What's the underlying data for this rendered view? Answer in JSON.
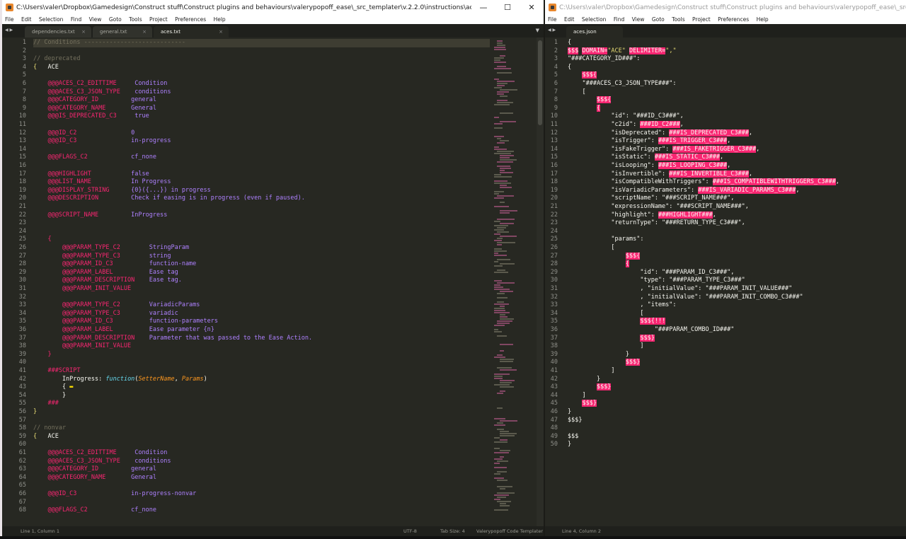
{
  "left_window": {
    "title": "C:\\Users\\valer\\Dropbox\\Gamedesign\\Construct stuff\\Construct plugins and behaviours\\valerypopoff_ease\\_src_templater\\v.2.2.0\\instructions\\aces.txt - Sublime Text (UNREGISTERED)",
    "controls": [
      "—",
      "☐",
      "✕"
    ],
    "menu": [
      "File",
      "Edit",
      "Selection",
      "Find",
      "View",
      "Goto",
      "Tools",
      "Project",
      "Preferences",
      "Help"
    ],
    "tabs": [
      "dependencies.txt",
      "general.txt",
      "aces.txt"
    ],
    "status": {
      "position": "Line 1, Column 1",
      "encoding": "UTF-8",
      "tab_size": "Tab Size: 4",
      "syntax": "Valerypopoff Code Templater"
    }
  },
  "right_window": {
    "title": "C:\\Users\\valer\\Dropbox\\Gamedesign\\Construct stuff\\Construct plugins and behaviours\\valerypopoff_ease\\_src_templater\\v.2.2.0\\templates\\###",
    "menu": [
      "File",
      "Edit",
      "Selection",
      "Find",
      "View",
      "Goto",
      "Tools",
      "Project",
      "Preferences",
      "Help"
    ],
    "tabs": [
      "aces.json"
    ],
    "status": {
      "position": "Line 4, Column 2"
    }
  },
  "left_code": [
    {
      "n": "1",
      "t": [
        [
          "c",
          "// Conditions ----------------------------"
        ]
      ]
    },
    {
      "n": "2",
      "t": []
    },
    {
      "n": "3",
      "t": [
        [
          "c",
          "// deprecated"
        ]
      ]
    },
    {
      "n": "4",
      "t": [
        [
          "s",
          "{"
        ],
        [
          "w",
          "   ACE"
        ]
      ]
    },
    {
      "n": "5",
      "t": []
    },
    {
      "n": "6",
      "t": [
        [
          "k",
          "    @@@ACES_C2_EDITTIME"
        ],
        [
          "v",
          "     Condition"
        ]
      ]
    },
    {
      "n": "7",
      "t": [
        [
          "k",
          "    @@@ACES_C3_JSON_TYPE"
        ],
        [
          "v",
          "    conditions"
        ]
      ]
    },
    {
      "n": "8",
      "t": [
        [
          "k",
          "    @@@CATEGORY_ID"
        ],
        [
          "v",
          "         general"
        ]
      ]
    },
    {
      "n": "9",
      "t": [
        [
          "k",
          "    @@@CATEGORY_NAME"
        ],
        [
          "v",
          "       General"
        ]
      ]
    },
    {
      "n": "10",
      "t": [
        [
          "k",
          "    @@@IS_DEPRECATED_C3"
        ],
        [
          "v",
          "     true"
        ]
      ]
    },
    {
      "n": "11",
      "t": []
    },
    {
      "n": "12",
      "t": [
        [
          "k",
          "    @@@ID_C2"
        ],
        [
          "v",
          "               0"
        ]
      ]
    },
    {
      "n": "13",
      "t": [
        [
          "k",
          "    @@@ID_C3"
        ],
        [
          "v",
          "               in-progress"
        ]
      ]
    },
    {
      "n": "14",
      "t": []
    },
    {
      "n": "15",
      "t": [
        [
          "k",
          "    @@@FLAGS_C2"
        ],
        [
          "v",
          "            cf_none"
        ]
      ]
    },
    {
      "n": "16",
      "t": []
    },
    {
      "n": "17",
      "t": [
        [
          "k",
          "    @@@HIGHLIGHT"
        ],
        [
          "v",
          "           false"
        ]
      ]
    },
    {
      "n": "18",
      "t": [
        [
          "k",
          "    @@@LIST_NAME"
        ],
        [
          "v",
          "           In Progress"
        ]
      ]
    },
    {
      "n": "19",
      "t": [
        [
          "k",
          "    @@@DISPLAY_STRING"
        ],
        [
          "v",
          "      {0}({...}) in progress"
        ]
      ]
    },
    {
      "n": "20",
      "t": [
        [
          "k",
          "    @@@DESCRIPTION"
        ],
        [
          "v",
          "         Check if easing is in progress (even if paused)."
        ]
      ]
    },
    {
      "n": "21",
      "t": []
    },
    {
      "n": "22",
      "t": [
        [
          "k",
          "    @@@SCRIPT_NAME"
        ],
        [
          "v",
          "         InProgress"
        ]
      ]
    },
    {
      "n": "23",
      "t": []
    },
    {
      "n": "24",
      "t": []
    },
    {
      "n": "25",
      "t": [
        [
          "k",
          "    {"
        ]
      ]
    },
    {
      "n": "26",
      "t": [
        [
          "k",
          "        @@@PARAM_TYPE_C2"
        ],
        [
          "v",
          "        StringParam"
        ]
      ]
    },
    {
      "n": "27",
      "t": [
        [
          "k",
          "        @@@PARAM_TYPE_C3"
        ],
        [
          "v",
          "        string"
        ]
      ]
    },
    {
      "n": "28",
      "t": [
        [
          "k",
          "        @@@PARAM_ID_C3"
        ],
        [
          "v",
          "          function-name"
        ]
      ]
    },
    {
      "n": "29",
      "t": [
        [
          "k",
          "        @@@PARAM_LABEL"
        ],
        [
          "v",
          "          Ease tag"
        ]
      ]
    },
    {
      "n": "30",
      "t": [
        [
          "k",
          "        @@@PARAM_DESCRIPTION"
        ],
        [
          "v",
          "    Ease tag."
        ]
      ]
    },
    {
      "n": "31",
      "t": [
        [
          "k",
          "        @@@PARAM_INIT_VALUE"
        ]
      ]
    },
    {
      "n": "32",
      "t": []
    },
    {
      "n": "33",
      "t": [
        [
          "k",
          "        @@@PARAM_TYPE_C2"
        ],
        [
          "v",
          "        VariadicParams"
        ]
      ]
    },
    {
      "n": "34",
      "t": [
        [
          "k",
          "        @@@PARAM_TYPE_C3"
        ],
        [
          "v",
          "        variadic"
        ]
      ]
    },
    {
      "n": "35",
      "t": [
        [
          "k",
          "        @@@PARAM_ID_C3"
        ],
        [
          "v",
          "          function-parameters"
        ]
      ]
    },
    {
      "n": "36",
      "t": [
        [
          "k",
          "        @@@PARAM_LABEL"
        ],
        [
          "v",
          "          Ease parameter {n}"
        ]
      ]
    },
    {
      "n": "37",
      "t": [
        [
          "k",
          "        @@@PARAM_DESCRIPTION"
        ],
        [
          "v",
          "    Parameter that was passed to the Ease Action."
        ]
      ]
    },
    {
      "n": "38",
      "t": [
        [
          "k",
          "        @@@PARAM_INIT_VALUE"
        ]
      ]
    },
    {
      "n": "39",
      "t": [
        [
          "k",
          "    }"
        ]
      ]
    },
    {
      "n": "40",
      "t": []
    },
    {
      "n": "41",
      "t": [
        [
          "k",
          "    ###SCRIPT"
        ]
      ]
    },
    {
      "n": "42",
      "t": [
        [
          "w",
          "        InProgress: "
        ],
        [
          "f",
          "function"
        ],
        [
          "w",
          "("
        ],
        [
          "p",
          "SetterName"
        ],
        [
          "w",
          ", "
        ],
        [
          "p",
          "Params"
        ],
        [
          "w",
          ")"
        ]
      ]
    },
    {
      "n": "43",
      "t": [
        [
          "w",
          "        { "
        ],
        [
          "dot",
          "▬"
        ]
      ]
    },
    {
      "n": "54",
      "t": [
        [
          "w",
          "        }"
        ]
      ]
    },
    {
      "n": "55",
      "t": [
        [
          "k",
          "    ###"
        ]
      ]
    },
    {
      "n": "56",
      "t": [
        [
          "s",
          "}"
        ]
      ]
    },
    {
      "n": "57",
      "t": []
    },
    {
      "n": "58",
      "t": [
        [
          "c",
          "// nonvar"
        ]
      ]
    },
    {
      "n": "59",
      "t": [
        [
          "s",
          "{"
        ],
        [
          "w",
          "   ACE"
        ]
      ]
    },
    {
      "n": "60",
      "t": []
    },
    {
      "n": "61",
      "t": [
        [
          "k",
          "    @@@ACES_C2_EDITTIME"
        ],
        [
          "v",
          "     Condition"
        ]
      ]
    },
    {
      "n": "62",
      "t": [
        [
          "k",
          "    @@@ACES_C3_JSON_TYPE"
        ],
        [
          "v",
          "    conditions"
        ]
      ]
    },
    {
      "n": "63",
      "t": [
        [
          "k",
          "    @@@CATEGORY_ID"
        ],
        [
          "v",
          "         general"
        ]
      ]
    },
    {
      "n": "64",
      "t": [
        [
          "k",
          "    @@@CATEGORY_NAME"
        ],
        [
          "v",
          "       General"
        ]
      ]
    },
    {
      "n": "65",
      "t": []
    },
    {
      "n": "66",
      "t": [
        [
          "k",
          "    @@@ID_C3"
        ],
        [
          "v",
          "               in-progress-nonvar"
        ]
      ]
    },
    {
      "n": "67",
      "t": []
    },
    {
      "n": "68",
      "t": [
        [
          "k",
          "    @@@FLAGS_C2"
        ],
        [
          "v",
          "            cf_none"
        ]
      ]
    }
  ],
  "right_code": [
    {
      "n": "1",
      "t": [
        [
          "w",
          "{"
        ]
      ]
    },
    {
      "n": "2",
      "t": [
        [
          "hl",
          "$$$"
        ],
        [
          "w",
          " "
        ],
        [
          "hl",
          "DOMAIN="
        ],
        [
          "s",
          "\"ACE\""
        ],
        [
          "w",
          " "
        ],
        [
          "hl",
          "DELIMITER="
        ],
        [
          "s",
          "\",\""
        ]
      ]
    },
    {
      "n": "3",
      "t": [
        [
          "w",
          "\"###CATEGORY_ID###\":"
        ]
      ]
    },
    {
      "n": "4",
      "t": [
        [
          "w",
          "{"
        ]
      ]
    },
    {
      "n": "5",
      "t": [
        [
          "w",
          "    "
        ],
        [
          "hl",
          "$$${"
        ]
      ]
    },
    {
      "n": "6",
      "t": [
        [
          "w",
          "    \"###ACES_C3_JSON_TYPE###\":"
        ]
      ]
    },
    {
      "n": "7",
      "t": [
        [
          "w",
          "    ["
        ]
      ]
    },
    {
      "n": "8",
      "t": [
        [
          "w",
          "        "
        ],
        [
          "hl",
          "$$${"
        ]
      ]
    },
    {
      "n": "9",
      "t": [
        [
          "w",
          "        "
        ],
        [
          "hl",
          "{"
        ]
      ]
    },
    {
      "n": "10",
      "t": [
        [
          "w",
          "            \"id\": \"###ID_C3###\","
        ]
      ]
    },
    {
      "n": "11",
      "t": [
        [
          "w",
          "            \"c2id\": "
        ],
        [
          "hl",
          "###ID_C2###"
        ],
        [
          "w",
          ","
        ]
      ]
    },
    {
      "n": "12",
      "t": [
        [
          "w",
          "            \"isDeprecated\": "
        ],
        [
          "hl",
          "###IS_DEPRECATED_C3###"
        ],
        [
          "w",
          ","
        ]
      ]
    },
    {
      "n": "13",
      "t": [
        [
          "w",
          "            \"isTrigger\": "
        ],
        [
          "hl",
          "###IS_TRIGGER_C3###"
        ],
        [
          "w",
          ","
        ]
      ]
    },
    {
      "n": "14",
      "t": [
        [
          "w",
          "            \"isFakeTrigger\": "
        ],
        [
          "hl",
          "###IS_FAKETRIGGER_C3###"
        ],
        [
          "w",
          ","
        ]
      ]
    },
    {
      "n": "15",
      "t": [
        [
          "w",
          "            \"isStatic\": "
        ],
        [
          "hl",
          "###IS_STATIC_C3###"
        ],
        [
          "w",
          ","
        ]
      ]
    },
    {
      "n": "16",
      "t": [
        [
          "w",
          "            \"isLooping\": "
        ],
        [
          "hl",
          "###IS_LOOPING_C3###"
        ],
        [
          "w",
          ","
        ]
      ]
    },
    {
      "n": "17",
      "t": [
        [
          "w",
          "            \"isInvertible\": "
        ],
        [
          "hl",
          "###IS_INVERTIBLE_C3###"
        ],
        [
          "w",
          ","
        ]
      ]
    },
    {
      "n": "18",
      "t": [
        [
          "w",
          "            \"isCompatibleWithTriggers\": "
        ],
        [
          "hl",
          "###IS_COMPATIBLEWITHTRIGGERS_C3###"
        ],
        [
          "w",
          ","
        ]
      ]
    },
    {
      "n": "19",
      "t": [
        [
          "w",
          "            \"isVariadicParameters\": "
        ],
        [
          "hl",
          "###IS_VARIADIC_PARAMS_C3###"
        ],
        [
          "w",
          ","
        ]
      ]
    },
    {
      "n": "20",
      "t": [
        [
          "w",
          "            \"scriptName\": \"###SCRIPT_NAME###\","
        ]
      ]
    },
    {
      "n": "21",
      "t": [
        [
          "w",
          "            \"expressionName\": \"###SCRIPT_NAME###\","
        ]
      ]
    },
    {
      "n": "22",
      "t": [
        [
          "w",
          "            \"highlight\": "
        ],
        [
          "hl",
          "###HIGHLIGHT###"
        ],
        [
          "w",
          ","
        ]
      ]
    },
    {
      "n": "23",
      "t": [
        [
          "w",
          "            \"returnType\": \"###RETURN_TYPE_C3###\","
        ]
      ]
    },
    {
      "n": "24",
      "t": []
    },
    {
      "n": "25",
      "t": [
        [
          "w",
          "            \"params\":"
        ]
      ]
    },
    {
      "n": "26",
      "t": [
        [
          "w",
          "            ["
        ]
      ]
    },
    {
      "n": "27",
      "t": [
        [
          "w",
          "                "
        ],
        [
          "hl",
          "$$${"
        ]
      ]
    },
    {
      "n": "28",
      "t": [
        [
          "w",
          "                "
        ],
        [
          "hl",
          "{"
        ]
      ]
    },
    {
      "n": "29",
      "t": [
        [
          "w",
          "                    \"id\": \"###PARAM_ID_C3###\","
        ]
      ]
    },
    {
      "n": "30",
      "t": [
        [
          "w",
          "                    \"type\": \"###PARAM_TYPE_C3###\""
        ]
      ]
    },
    {
      "n": "31",
      "t": [
        [
          "w",
          "                    , \"initialValue\": \"###PARAM_INIT_VALUE###\""
        ]
      ]
    },
    {
      "n": "32",
      "t": [
        [
          "w",
          "                    , \"initialValue\": \"###PARAM_INIT_COMBO_C3###\""
        ]
      ]
    },
    {
      "n": "33",
      "t": [
        [
          "w",
          "                    , \"items\":"
        ]
      ]
    },
    {
      "n": "34",
      "t": [
        [
          "w",
          "                    ["
        ]
      ]
    },
    {
      "n": "35",
      "t": [
        [
          "w",
          "                    "
        ],
        [
          "hl",
          "$$${!!!"
        ]
      ]
    },
    {
      "n": "36",
      "t": [
        [
          "w",
          "                        \"###PARAM_COMBO_ID###\""
        ]
      ]
    },
    {
      "n": "37",
      "t": [
        [
          "w",
          "                    "
        ],
        [
          "hl",
          "$$$}"
        ]
      ]
    },
    {
      "n": "38",
      "t": [
        [
          "w",
          "                    ]"
        ]
      ]
    },
    {
      "n": "39",
      "t": [
        [
          "w",
          "                }"
        ]
      ]
    },
    {
      "n": "40",
      "t": [
        [
          "w",
          "                "
        ],
        [
          "hl",
          "$$$}"
        ]
      ]
    },
    {
      "n": "41",
      "t": [
        [
          "w",
          "            ]"
        ]
      ]
    },
    {
      "n": "42",
      "t": [
        [
          "w",
          "        }"
        ]
      ]
    },
    {
      "n": "43",
      "t": [
        [
          "w",
          "        "
        ],
        [
          "hl",
          "$$$}"
        ]
      ]
    },
    {
      "n": "44",
      "t": [
        [
          "w",
          "    ]"
        ]
      ]
    },
    {
      "n": "45",
      "t": [
        [
          "w",
          "    "
        ],
        [
          "hl",
          "$$$}"
        ]
      ]
    },
    {
      "n": "46",
      "t": [
        [
          "w",
          "}"
        ]
      ]
    },
    {
      "n": "47",
      "t": [
        [
          "w",
          "$$$}"
        ]
      ]
    },
    {
      "n": "48",
      "t": []
    },
    {
      "n": "49",
      "t": [
        [
          "w",
          "$$$"
        ]
      ]
    },
    {
      "n": "50",
      "t": [
        [
          "w",
          "}"
        ]
      ]
    }
  ],
  "colors": {
    "editor_bg": "#272822",
    "keyword": "#f92672",
    "value": "#ae81ff",
    "comment": "#75715e",
    "brace": "#e6db74",
    "highlight_bg": "#f92672"
  }
}
